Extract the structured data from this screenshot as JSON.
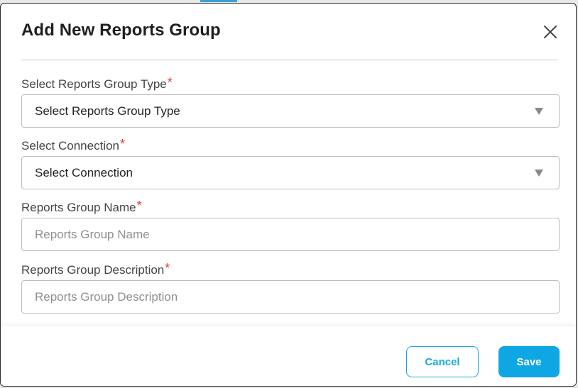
{
  "dialog": {
    "title": "Add New Reports Group",
    "close_icon": "close-icon"
  },
  "fields": {
    "group_type": {
      "label": "Select Reports Group Type",
      "required_mark": "*",
      "value": "Select Reports Group Type"
    },
    "connection": {
      "label": "Select Connection",
      "required_mark": "*",
      "value": "Select Connection"
    },
    "group_name": {
      "label": "Reports Group Name",
      "required_mark": "*",
      "value": "",
      "placeholder": "Reports Group Name"
    },
    "group_description": {
      "label": "Reports Group Description",
      "required_mark": "*",
      "value": "",
      "placeholder": "Reports Group Description"
    }
  },
  "footer": {
    "cancel_label": "Cancel",
    "save_label": "Save"
  },
  "colors": {
    "accent": "#0fa7e3",
    "required": "#e53935"
  }
}
